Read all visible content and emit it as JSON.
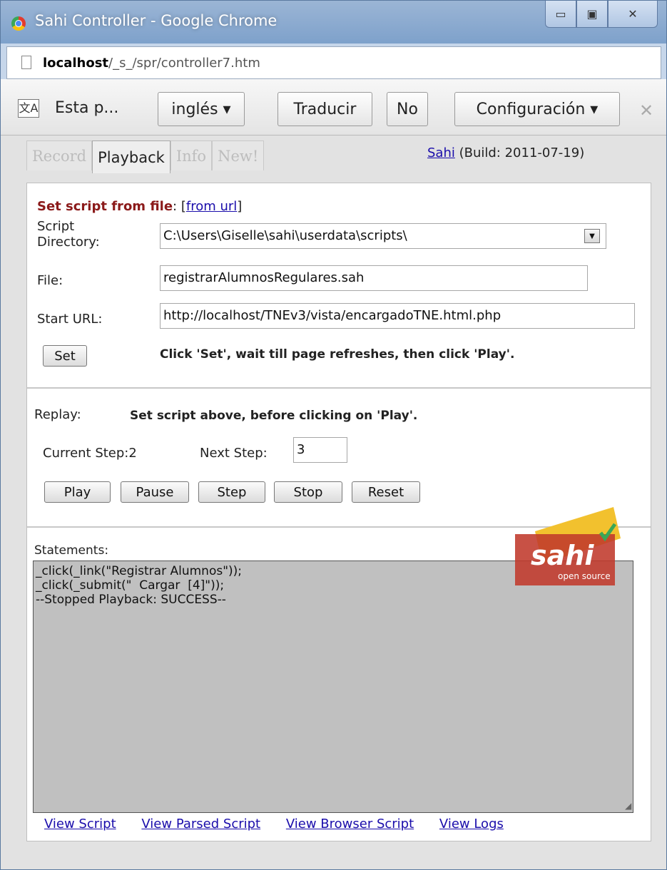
{
  "window": {
    "title": "Sahi Controller - Google Chrome",
    "min_symbol": "▭",
    "max_symbol": "▣",
    "close_symbol": "✕"
  },
  "address": {
    "host": "localhost",
    "path": "/_s_/spr/controller7.htm"
  },
  "translate": {
    "icon_label": "文A",
    "text": "Esta p...",
    "language": "inglés ▾",
    "translate_label": "Traducir",
    "no_label": "No",
    "config_label": "Configuración ▾",
    "close_symbol": "✕"
  },
  "tabs": [
    "Record",
    "Playback",
    "Info",
    "New!"
  ],
  "build": {
    "link": "Sahi",
    "text": " (Build: 2011-07-19)"
  },
  "script_form": {
    "heading": "Set script from file",
    "colon": ":",
    "from_url_open": " [",
    "from_url_link": "from url",
    "from_url_close": "]",
    "script_dir_label_1": "Script",
    "script_dir_label_2": "Directory:",
    "script_dir_value": "C:\\Users\\Giselle\\sahi\\userdata\\scripts\\",
    "file_label": "File:",
    "file_value": "registrarAlumnosRegulares.sah",
    "start_url_label": "Start URL:",
    "start_url_value": "http://localhost/TNEv3/vista/encargadoTNE.html.php",
    "set_button": "Set",
    "set_hint": "Click 'Set', wait till page refreshes, then click 'Play'."
  },
  "replay": {
    "label": "Replay:",
    "hint": "Set script above, before clicking on 'Play'.",
    "current_step_label": "Current Step:2",
    "next_step_label": "Next Step:",
    "next_step_value": "3",
    "buttons": [
      "Play",
      "Pause",
      "Step",
      "Stop",
      "Reset"
    ]
  },
  "statements": {
    "label": "Statements:",
    "text": "_click(_link(\"Registrar Alumnos\"));\n_click(_submit(\"  Cargar  [4]\"));\n--Stopped Playback: SUCCESS--"
  },
  "logo": {
    "brand": "sahi",
    "tagline": "open source"
  },
  "links": [
    "View Script",
    "View Parsed Script",
    "View Browser Script",
    "View Logs"
  ]
}
